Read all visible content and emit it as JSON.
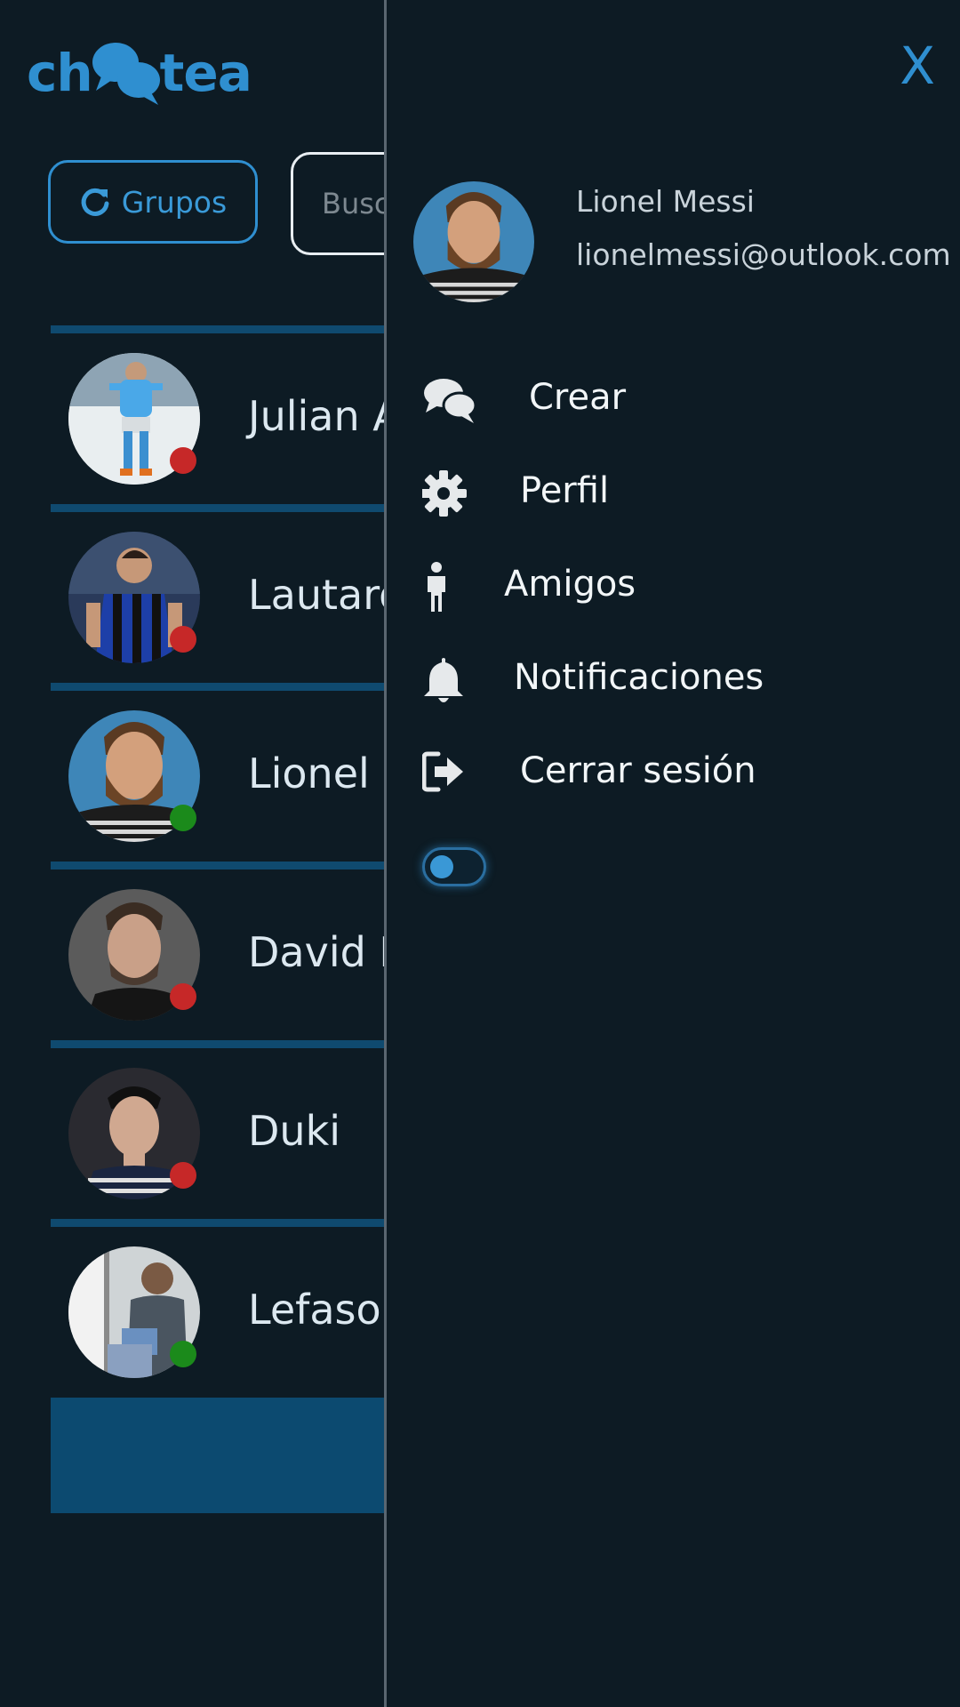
{
  "app": {
    "logo_left": "ch",
    "logo_right": "tea"
  },
  "toolbar": {
    "groups_label": "Grupos",
    "search_placeholder": "Buscar"
  },
  "contacts": [
    {
      "name": "Julian Alvarez",
      "status": "offline",
      "status_color": "#c62828"
    },
    {
      "name": "Lautaro Martinez",
      "status": "offline",
      "status_color": "#c62828"
    },
    {
      "name": "Lionel Messi",
      "status": "online",
      "status_color": "#1b8a1b"
    },
    {
      "name": "David Beckham",
      "status": "offline",
      "status_color": "#c62828"
    },
    {
      "name": "Duki",
      "status": "offline",
      "status_color": "#c62828"
    },
    {
      "name": "Lefasor",
      "status": "online",
      "status_color": "#1b8a1b"
    }
  ],
  "drawer": {
    "close_label": "X",
    "profile": {
      "name": "Lionel Messi",
      "email": "lionelmessi@outlook.com"
    },
    "menu": [
      {
        "label": "Crear",
        "icon": "chat-bubbles-icon"
      },
      {
        "label": "Perfil",
        "icon": "gear-icon"
      },
      {
        "label": "Amigos",
        "icon": "person-icon"
      },
      {
        "label": "Notificaciones",
        "icon": "bell-icon"
      },
      {
        "label": "Cerrar sesión",
        "icon": "logout-icon"
      }
    ],
    "theme_toggle": "off"
  },
  "colors": {
    "background": "#0d1b24",
    "accent": "#2f8fd0",
    "divider": "#0f4a6f"
  }
}
